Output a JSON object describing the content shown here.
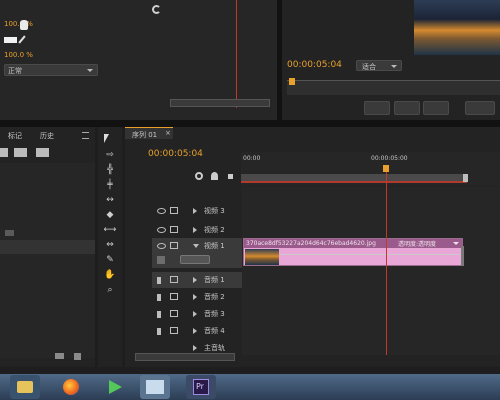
{
  "effects_panel": {
    "opacity_value": "100.0 %",
    "lower_value": "100.0 %",
    "blend_mode": "正常"
  },
  "program_monitor": {
    "timecode": "00:00:05:04",
    "fit_label": "适合"
  },
  "project_panel": {
    "tabs": [
      "标记",
      "历史"
    ]
  },
  "sequence": {
    "tab_label": "序列 01",
    "timecode": "00:00:05:04",
    "ruler_start": "00:00",
    "ruler_mid": "00:00:05:00"
  },
  "tracks": {
    "video": [
      "视频 3",
      "视频 2",
      "视频 1"
    ],
    "audio": [
      "音频 1",
      "音频 2",
      "音频 3",
      "音频 4"
    ],
    "master": "主音轨"
  },
  "clip": {
    "label": "370ace8df53227a204d64c76ebad4620.jpg",
    "effect": "透明度:透明度",
    "color": "#e8a7d6"
  },
  "colors": {
    "accent": "#e9a12b",
    "playhead": "#c0392b",
    "taskbar": "#3a4d66"
  },
  "taskbar": {
    "items": [
      "file-explorer-icon",
      "firefox-icon",
      "media-player-icon",
      "window-icon",
      "premiere-icon"
    ],
    "premiere_label": "Pr"
  }
}
